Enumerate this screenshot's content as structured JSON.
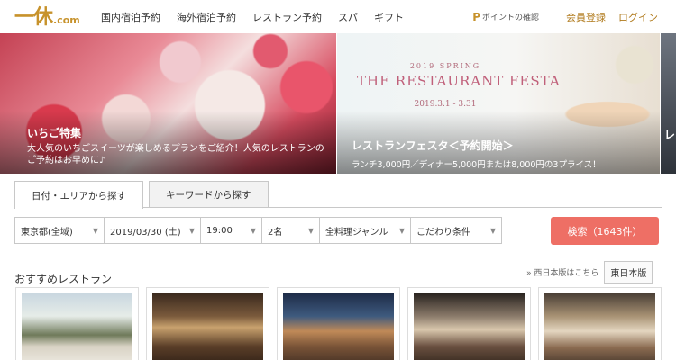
{
  "header": {
    "logo_mark": "一休",
    "logo_domain": ".com",
    "nav": [
      "国内宿泊予約",
      "海外宿泊予約",
      "レストラン予約",
      "スパ",
      "ギフト"
    ],
    "point_icon": "P",
    "point_label": "ポイントの確認",
    "register_label": "会員登録",
    "login_label": "ログイン"
  },
  "banner": {
    "slide1": {
      "title": "いちご特集",
      "desc": "大人気のいちごスイーツが楽しめるプランをご紹介！人気のレストランのご予約はお早めに♪"
    },
    "slide2": {
      "season": "2019 SPRING",
      "festa_name": "THE RESTAURANT FESTA",
      "festa_date": "2019.3.1 - 3.31",
      "title": "レストランフェスタ＜予約開始＞",
      "desc": "ランチ3,000円／ディナー5,000円または8,000円の3プライス！"
    },
    "slide3": {
      "peek": "レ"
    }
  },
  "search": {
    "tabs": [
      "日付・エリアから探す",
      "キーワードから探す"
    ],
    "area": "東京都(全域)",
    "date": "2019/03/30 (土)",
    "time": "19:00",
    "people": "2名",
    "genre": "全料理ジャンル",
    "conditions": "こだわり条件",
    "button": "検索（1643件）"
  },
  "recommend": {
    "title": "おすすめレストラン",
    "west_link": "» 西日本版はこちら",
    "east_label": "東日本版"
  }
}
